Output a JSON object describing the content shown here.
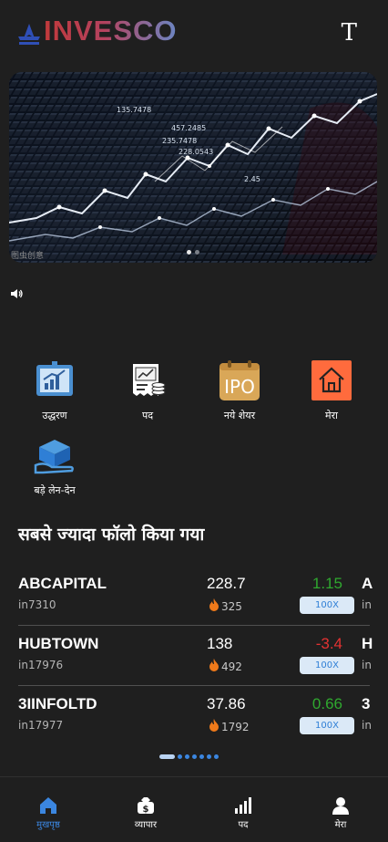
{
  "header": {
    "brand": "INVESCO",
    "font_toggle": "T"
  },
  "banner": {
    "watermark": "图虫创意",
    "slide_count": 2,
    "active_slide": 1,
    "overlay_numbers": [
      "457.2485",
      "235.7478",
      "228.0543",
      "135.7478",
      "2.45"
    ]
  },
  "quick_actions": [
    {
      "label": "उद्धरण",
      "icon": "quote-chart-icon"
    },
    {
      "label": "पद",
      "icon": "position-receipt-icon"
    },
    {
      "label": "नये शेयर",
      "icon": "ipo-calendar-icon",
      "icon_text": "IPO"
    },
    {
      "label": "मेरा",
      "icon": "home-icon"
    },
    {
      "label": "बड़े लेन-देन",
      "icon": "block-trade-icon"
    }
  ],
  "section_title": "सबसे ज्यादा फॉलो किया गया",
  "stocks": [
    {
      "name": "ABCAPITAL",
      "code": "in7310",
      "price": "228.7",
      "heat": "325",
      "change": "1.15",
      "direction": "up",
      "leverage": "100X",
      "peek_name": "A",
      "peek_code": "in"
    },
    {
      "name": "HUBTOWN",
      "code": "in17976",
      "price": "138",
      "heat": "492",
      "change": "-3.4",
      "direction": "down",
      "leverage": "100X",
      "peek_name": "H",
      "peek_code": "in"
    },
    {
      "name": "3IINFOLTD",
      "code": "in17977",
      "price": "37.86",
      "heat": "1792",
      "change": "0.66",
      "direction": "up",
      "leverage": "100X",
      "peek_name": "3",
      "peek_code": "in"
    }
  ],
  "tabs": [
    {
      "label": "मुखपृष्ठ",
      "active": true
    },
    {
      "label": "व्यापार",
      "active": false
    },
    {
      "label": "पद",
      "active": false
    },
    {
      "label": "मेरा",
      "active": false
    }
  ],
  "colors": {
    "background": "#1f1f1f",
    "accent_blue": "#3b86e0",
    "up_green": "#2fa82f",
    "down_red": "#e33232",
    "leverage_bg": "#dbe9f7"
  }
}
